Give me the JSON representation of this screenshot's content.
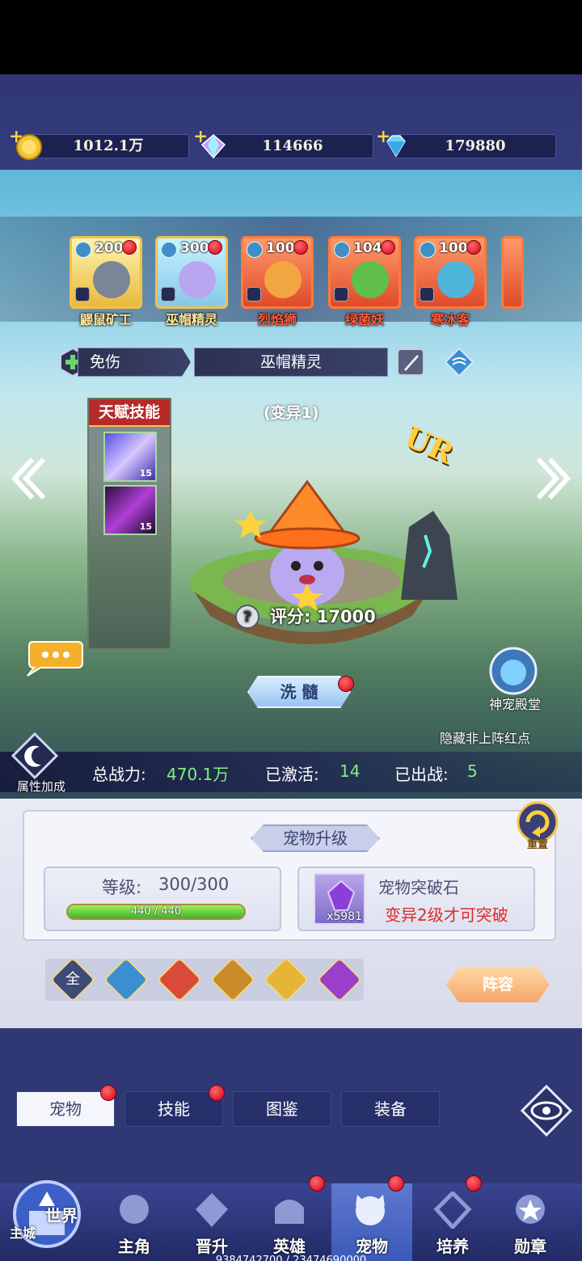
{
  "resources": {
    "gold": "1012.1万",
    "crystal": "114666",
    "diamond": "179880"
  },
  "pets": [
    {
      "level": "200",
      "name": "鼹鼠矿工"
    },
    {
      "level": "300",
      "name": "巫帽精灵"
    },
    {
      "level": "100",
      "name": "烈焰狮"
    },
    {
      "level": "104",
      "name": "绿菌妖"
    },
    {
      "level": "100",
      "name": "寒冰客"
    }
  ],
  "selected": {
    "trait": "免伤",
    "name": "巫帽精灵",
    "mutation": "(变异1)",
    "rarity": "UR",
    "score_label": "评分:",
    "score": "17000"
  },
  "talent": {
    "title": "天赋技能",
    "skills": [
      {
        "level": "15"
      },
      {
        "level": "15"
      }
    ]
  },
  "wash_button": "洗 髓",
  "temple_label": "神宠殿堂",
  "hide_red_dot": "隐藏非上阵红点",
  "attr_bonus": "属性加成",
  "stats": {
    "power_label": "总战力:",
    "power": "470.1万",
    "activated_label": "已激活:",
    "activated": "14",
    "deployed_label": "已出战:",
    "deployed": "5"
  },
  "upgrade": {
    "title": "宠物升级",
    "reset": "重置",
    "level_label": "等级:",
    "level": "300/300",
    "exp": "440 / 440",
    "exp_fraction": 1.0,
    "stone_name": "宠物突破石",
    "stone_count": "x5981",
    "stone_note": "变异2级才可突破"
  },
  "filters": [
    "全"
  ],
  "lineup_button": "阵容",
  "subtabs": [
    "宠物",
    "技能",
    "图鉴",
    "装备"
  ],
  "nav": {
    "world": "世界",
    "main_city": "主城",
    "items": [
      "主角",
      "晋升",
      "英雄",
      "宠物",
      "培养",
      "勋章"
    ]
  },
  "footer": "9384742700 / 23474690000"
}
